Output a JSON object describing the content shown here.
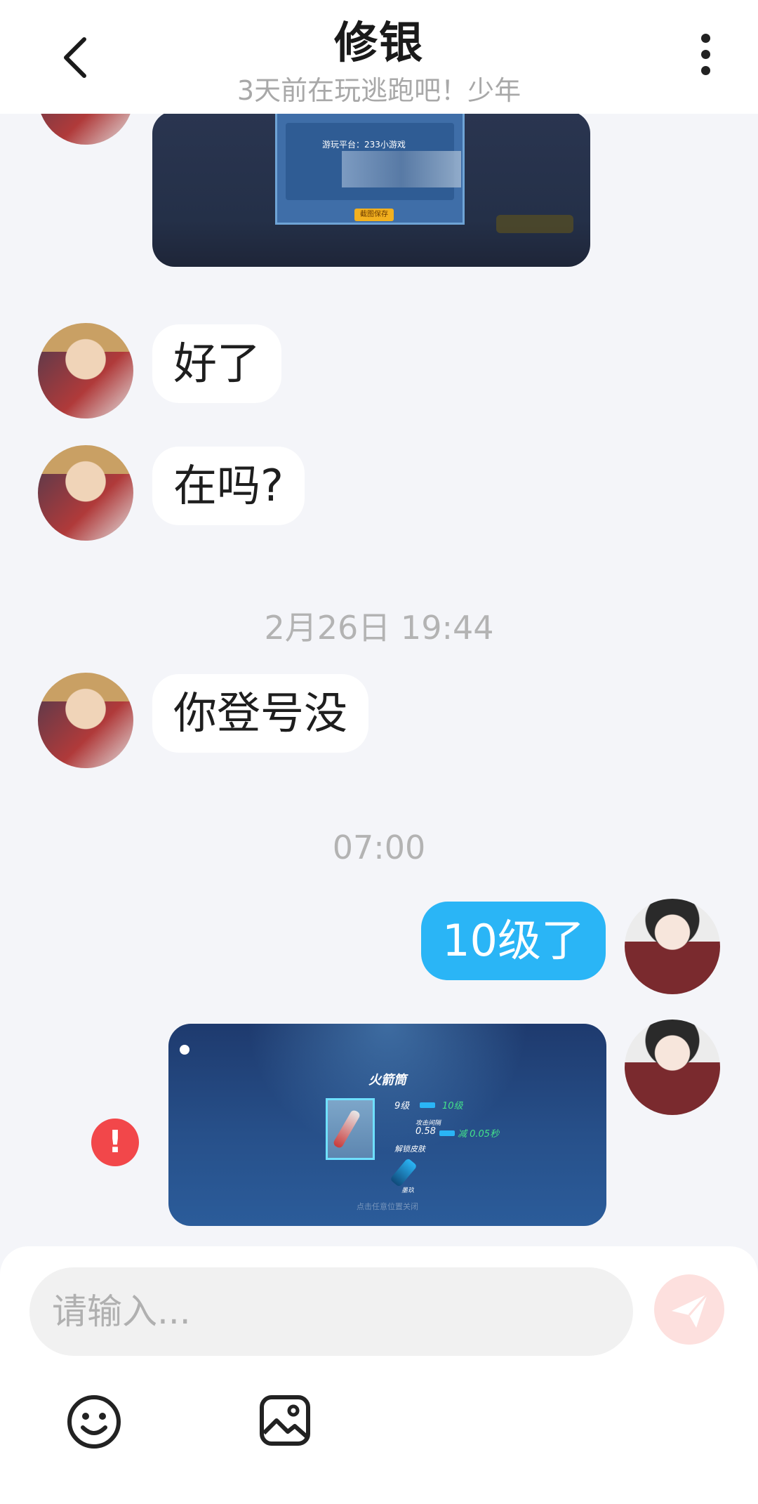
{
  "header": {
    "title": "修银",
    "subtitle": "3天前在玩逃跑吧！少年"
  },
  "messages": {
    "top_image": {
      "panel_text": "游玩平台：233小游戏",
      "save_label": "截图保存"
    },
    "msg1": "好了",
    "msg2": "在吗?",
    "time1": "2月26日 19:44",
    "msg3": "你登号没",
    "time2": "07:00",
    "msg4": "10级了",
    "bottom_image": {
      "title": "火箭筒",
      "level_from": "9级",
      "level_to": "10级",
      "stat_label": "攻击间隔",
      "stat_value": "0.58",
      "stat_change": "减 0.05秒",
      "unlock_label": "解锁皮肤",
      "skin_label": "墨玖",
      "caption": "点击任意位置关闭"
    },
    "error_glyph": "!"
  },
  "composer": {
    "placeholder": "请输入..."
  },
  "icons": {
    "back": "chevron-left-icon",
    "more": "more-vertical-icon",
    "send": "paper-plane-icon",
    "emoji": "smiley-icon",
    "image": "image-icon",
    "error": "error-icon"
  },
  "colors": {
    "self_bubble": "#2ab5f6",
    "error": "#f2474a",
    "send_disabled": "#fde0de"
  }
}
